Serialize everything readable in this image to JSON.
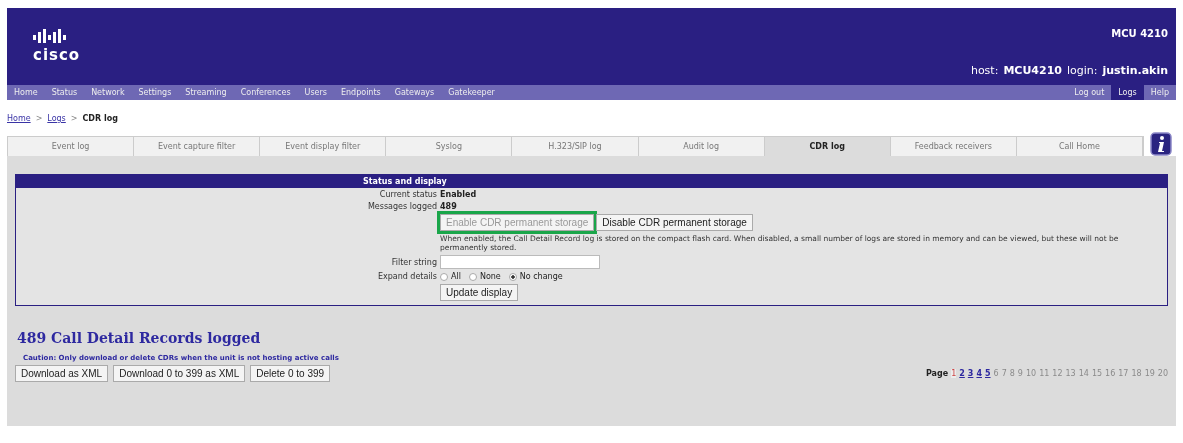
{
  "header": {
    "logo": "cisco",
    "model": "MCU 4210",
    "host_label": "host:",
    "host": "MCU4210",
    "login_label": "login:",
    "login": "justin.akin"
  },
  "nav": [
    {
      "label": "Home"
    },
    {
      "label": "Status"
    },
    {
      "label": "Network"
    },
    {
      "label": "Settings"
    },
    {
      "label": "Streaming"
    },
    {
      "label": "Conferences"
    },
    {
      "label": "Users"
    },
    {
      "label": "Endpoints"
    },
    {
      "label": "Gateways"
    },
    {
      "label": "Gatekeeper"
    }
  ],
  "nav_right": [
    {
      "label": "Log out",
      "selected": false
    },
    {
      "label": "Logs",
      "selected": true
    },
    {
      "label": "Help",
      "selected": false
    }
  ],
  "breadcrumb": [
    {
      "label": "Home",
      "link": true
    },
    {
      "label": "Logs",
      "link": true
    },
    {
      "label": "CDR log",
      "link": false
    }
  ],
  "breadcrumb_separator": ">",
  "tabs": [
    {
      "label": "Event log",
      "selected": false
    },
    {
      "label": "Event capture filter",
      "selected": false
    },
    {
      "label": "Event display filter",
      "selected": false
    },
    {
      "label": "Syslog",
      "selected": false
    },
    {
      "label": "H.323/SIP log",
      "selected": false
    },
    {
      "label": "Audit log",
      "selected": false
    },
    {
      "label": "CDR log",
      "selected": true
    },
    {
      "label": "Feedback receivers",
      "selected": false
    },
    {
      "label": "Call Home",
      "selected": false
    }
  ],
  "status_panel": {
    "title": "Status and display",
    "current_status_label": "Current status",
    "current_status": "Enabled",
    "messages_logged_label": "Messages logged",
    "messages_logged": "489",
    "buttons": [
      {
        "label": "Enable CDR permanent storage",
        "disabled": true,
        "highlighted": true
      },
      {
        "label": "Disable CDR permanent storage",
        "disabled": false,
        "highlighted": false
      }
    ],
    "note": "When enabled, the Call Detail Record log is stored on the compact flash card. When disabled, a small number of logs are stored in memory and can be viewed, but these will not be permanently stored.",
    "filter_label": "Filter string",
    "expand_label": "Expand details",
    "expand_options": [
      {
        "label": "All",
        "selected": false
      },
      {
        "label": "None",
        "selected": false
      },
      {
        "label": "No change",
        "selected": true
      }
    ],
    "update_button": "Update display"
  },
  "records_heading": "489 Call Detail Records logged",
  "caution": "Caution: Only download or delete CDRs when the unit is not hosting active calls",
  "actions": [
    "Download as XML",
    "Download 0 to 399 as XML",
    "Delete 0 to 399"
  ],
  "pager": {
    "label": "Page",
    "pages": [
      {
        "label": "1",
        "selected": true,
        "disabled": false
      },
      {
        "label": "2",
        "selected": false,
        "disabled": false
      },
      {
        "label": "3",
        "selected": false,
        "disabled": false
      },
      {
        "label": "4",
        "selected": false,
        "disabled": false
      },
      {
        "label": "5",
        "selected": false,
        "disabled": false
      },
      {
        "label": "6",
        "selected": false,
        "disabled": true
      },
      {
        "label": "7",
        "selected": false,
        "disabled": true
      },
      {
        "label": "8",
        "selected": false,
        "disabled": true
      },
      {
        "label": "9",
        "selected": false,
        "disabled": true
      },
      {
        "label": "10",
        "selected": false,
        "disabled": true
      },
      {
        "label": "11",
        "selected": false,
        "disabled": true
      },
      {
        "label": "12",
        "selected": false,
        "disabled": true
      },
      {
        "label": "13",
        "selected": false,
        "disabled": true
      },
      {
        "label": "14",
        "selected": false,
        "disabled": true
      },
      {
        "label": "15",
        "selected": false,
        "disabled": true
      },
      {
        "label": "16",
        "selected": false,
        "disabled": true
      },
      {
        "label": "17",
        "selected": false,
        "disabled": true
      },
      {
        "label": "18",
        "selected": false,
        "disabled": true
      },
      {
        "label": "19",
        "selected": false,
        "disabled": true
      },
      {
        "label": "20",
        "selected": false,
        "disabled": true
      }
    ]
  }
}
